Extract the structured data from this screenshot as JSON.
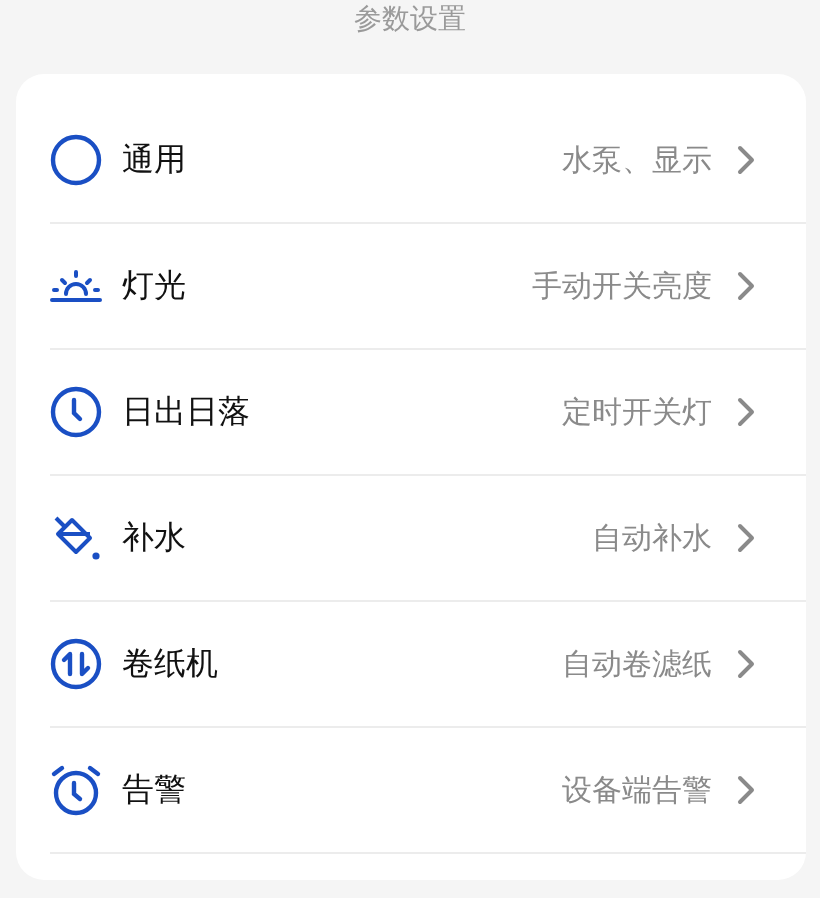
{
  "title": "参数设置",
  "items": [
    {
      "label": "通用",
      "value": "水泵、显示"
    },
    {
      "label": "灯光",
      "value": "手动开关亮度"
    },
    {
      "label": "日出日落",
      "value": "定时开关灯"
    },
    {
      "label": "补水",
      "value": "自动补水"
    },
    {
      "label": "卷纸机",
      "value": "自动卷滤纸"
    },
    {
      "label": "告警",
      "value": "设备端告警"
    }
  ]
}
